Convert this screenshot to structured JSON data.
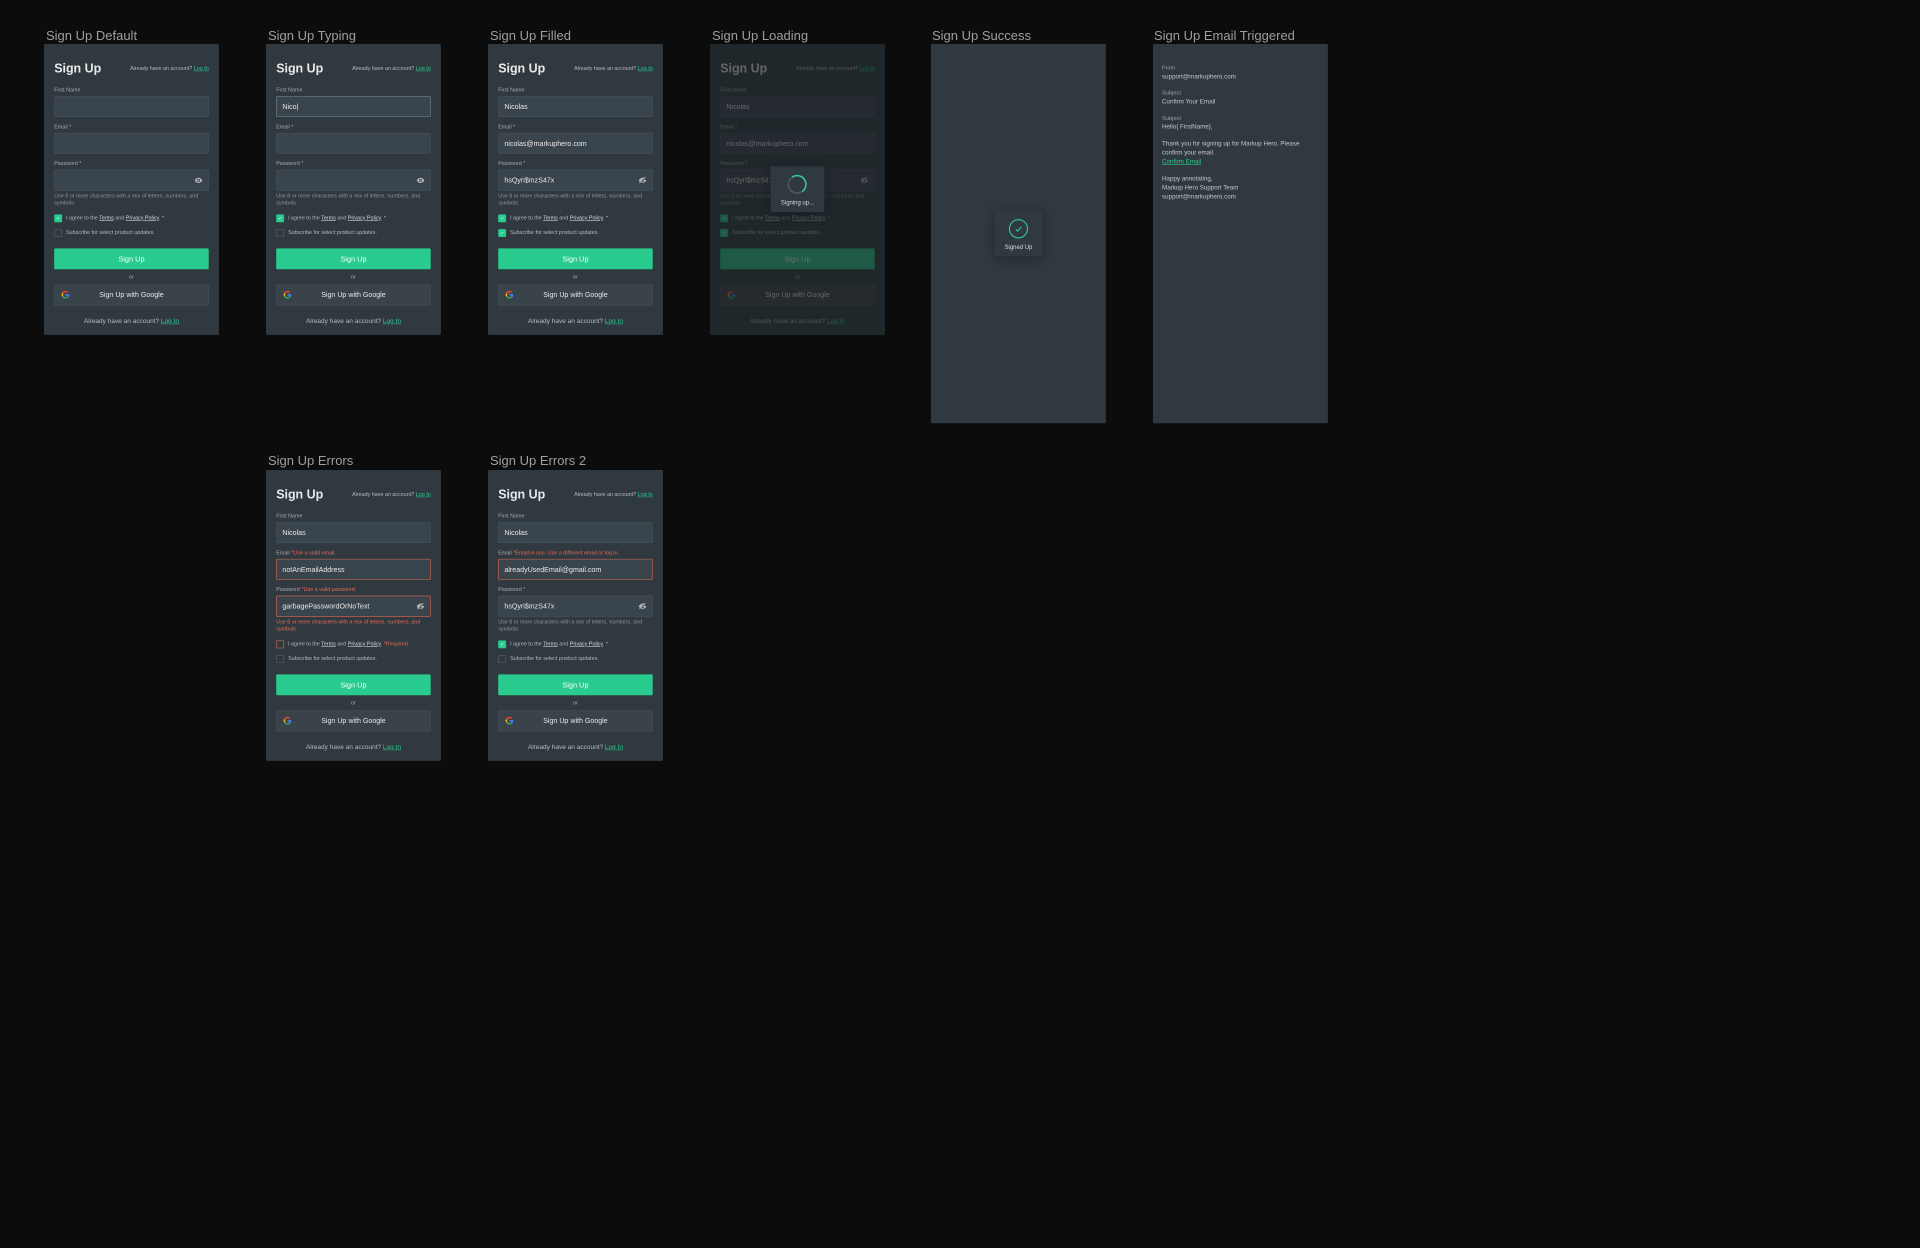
{
  "frames": {
    "default": "Sign Up Default",
    "typing": "Sign Up Typing",
    "filled": "Sign Up Filled",
    "loading": "Sign Up Loading",
    "success": "Sign Up Success",
    "email": "Sign Up Email Triggered",
    "errors": "Sign Up Errors",
    "errors2": "Sign Up Errors 2"
  },
  "card": {
    "title": "Sign Up",
    "top_already": "Already have an account?",
    "top_login": "Log In",
    "bottom_already": "Already have an account?",
    "bottom_login": "Log In",
    "labels": {
      "first_name": "First Name",
      "email": "Email *",
      "email_plain": "Email",
      "password": "Password *",
      "password_plain": "Password"
    },
    "hint_password": "Use 8 or more characters with a mix of letters, numbers, and symbols.",
    "agree_pre": "I agree to the",
    "terms": "Terms",
    "and": "and",
    "privacy": "Privacy Policy",
    "agree_dot": ". *",
    "agree_required": ". *Required",
    "subscribe": "Subscribe for select product updates.",
    "btn_signup": "Sign Up",
    "or": "or",
    "btn_google": "Sign Up with Google"
  },
  "values": {
    "typing_first_name": "Nico|",
    "filled_first_name": "Nicolas",
    "filled_email": "nicolas@markuphero.com",
    "filled_password": "hsQyri$mzS47x",
    "errors_first_name": "Nicolas",
    "errors_email": "notAnEmailAddress",
    "errors_password": "garbagePasswordOrNoText",
    "errors2_first_name": "Nicolas",
    "errors2_email": "alreadyUsedEmail@gmail.com",
    "errors2_password": "hsQyri$mzS47x"
  },
  "errors": {
    "email_invalid": "*Use a valid email.",
    "email_in_use": "*Email in use. Use a different email or log in.",
    "password_invalid": "*Use a valid password.",
    "password_hint_error": "Use 8 or more characters with a mix of letters, numbers, and symbols."
  },
  "status": {
    "signing_up": "Signing up...",
    "signed_up": "Signed Up"
  },
  "email": {
    "from_label": "From",
    "from_value": "support@markuphero.com",
    "subject_label": "Subject",
    "subject_value": "Confirm Your Email",
    "subject_label2": "Subject",
    "greeting": "Hello{ FirstName},",
    "body": "Thank you for signing up for Markup Hero. Please confirm your email.",
    "confirm": "Confirm Email",
    "sig1": "Happy annotating,",
    "sig2": "Markup Hero Support Team",
    "sig3": "support@markuphero.com"
  }
}
